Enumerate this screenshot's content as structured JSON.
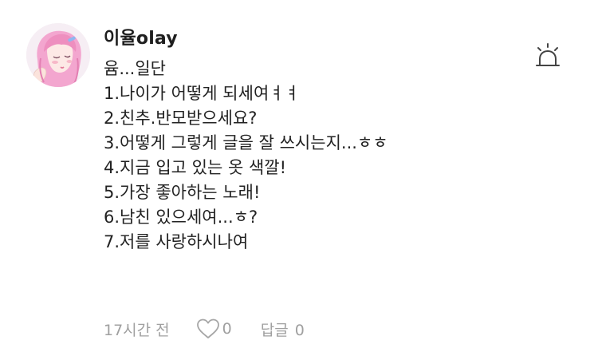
{
  "comment": {
    "author": "이율olay",
    "lines": [
      "윰...일단",
      "1.나이가 어떻게 되세여ㅕㅕ",
      "2.친추.반모받으세요?",
      "3.어떻게 그렇게 글을 잘 쓰시는지...ㅎㅎ",
      "4.지금 입고 있는 옷 색깔!",
      "5.가장 좋아하는 노래!",
      "6.남친 있으세여...ㅎ?",
      "7.저를 사랑하시나여"
    ],
    "timestamp": "17시간 전",
    "like_count": "0",
    "reply_label": "답글",
    "reply_count": "0",
    "icons": {
      "report": "siren-icon",
      "like": "heart-outline-icon"
    }
  }
}
